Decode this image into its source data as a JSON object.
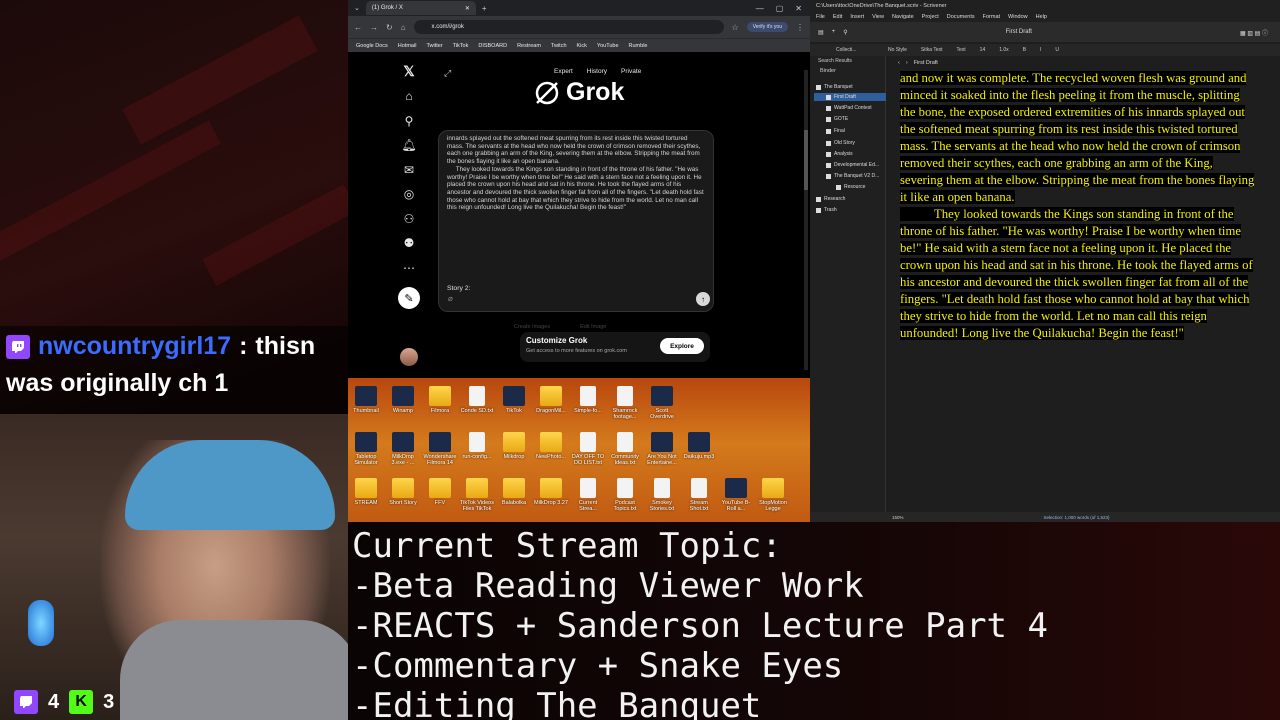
{
  "chat": {
    "username": "nwcountrygirl17",
    "colon": ":",
    "message_part1": "thisn",
    "message_part2": "was originally ch 1"
  },
  "counters": {
    "twitch_count": "4",
    "kick_count": "3",
    "kick_letter": "K"
  },
  "browser": {
    "tab_title": "(1) Grok / X",
    "url": "x.com/i/grok",
    "verify_label": "Verify it's you",
    "bookmarks": [
      "Google Docs",
      "Hotmail",
      "Twitter",
      "TikTok",
      "DISBOARD",
      "Restream",
      "Twitch",
      "Kick",
      "YouTube",
      "Rumble"
    ]
  },
  "grok": {
    "mode": "Expert",
    "history": "History",
    "private": "Private",
    "logo_text": "Grok",
    "message": "innards splayed out the softened meat spurring from its rest inside this twisted tortured mass. The servants at the head who now held the crown of crimson removed their scythes, each one grabbing an arm of the King, severing them at the elbow. Stripping the meat from the bones flaying it like an open banana.\n     They looked towards the Kings son standing in front of the throne of his father. \"He was worthy! Praise I be worthy when time be!\" He said with a stern face not a feeling upon it. He placed the crown upon his head and sat in his throne. He took the flayed arms of his ancestor and devoured the thick swollen finger fat from all of the fingers. \"Let death hold fast those who cannot hold at bay that which they strive to hide from the world. Let no man call this reign unfounded! Long live the Quilakucha! Begin the feast!\"",
    "story_label": "Story 2:",
    "ghost_create": "Create Images",
    "ghost_edit": "Edit Image",
    "customize_title": "Customize Grok",
    "customize_sub": "Get access to more features on grok.com",
    "explore": "Explore"
  },
  "desktop": {
    "row1": [
      "Thumbnail",
      "Winamp",
      "Filmora",
      "Conde SD.txt",
      "TikTok",
      "DragonMil...",
      "Simple-fo...",
      "Shamrock footage...",
      "Scott Overdrive"
    ],
    "row2": [
      "Tabletop Simulator",
      "MilkDrop 3.exe - ...",
      "Wondershare Filmora 14",
      "run-config...",
      "Milkdrop",
      "NewPhoto...",
      "DAY OFF TO DO LIST.txt",
      "Community Ideas.txt",
      "Are You Not Entertaine...",
      "Daikuju.mp3"
    ],
    "row3": [
      "STREAM",
      "Short Story",
      "FFV",
      "TikTok Videos Files TikTok",
      "Balabolka",
      "MilkDrop 3.27",
      "Current Strea...",
      "Podcast Topics.txt",
      "Smokey Stories.txt",
      "Stream Shot.txt",
      "YouTube B-Roll a...",
      "StopMotion Legge"
    ]
  },
  "scrivener": {
    "window_title": "C:\\Users\\ttoc\\OneDrive\\The Banquet.scriv - Scrivener",
    "menu": [
      "File",
      "Edit",
      "Insert",
      "View",
      "Navigate",
      "Project",
      "Documents",
      "Format",
      "Window",
      "Help"
    ],
    "toolbar_doc": "First Draft",
    "collections": "Collecti...",
    "format_bar": [
      "No Style",
      "Sitka Text",
      "Text",
      "14",
      "1.0x"
    ],
    "binder_header": "Binder",
    "search_results": "Search Results",
    "binder": [
      "The Banquet",
      "First Draft",
      "WattPad Contest",
      "GOTE",
      "Final",
      "Old Story",
      "Analysis",
      "Developmental Ed...",
      "The Banquet V2 D...",
      "Resource",
      "Research",
      "Trash"
    ],
    "editor_title": "First Draft",
    "editor_text_1": "and now it was complete. The recycled woven flesh was ground and minced it soaked into the flesh peeling it from the muscle, splitting the bone, the exposed ordered extremities of his innards splayed out the softened meat spurring from its rest inside this twisted tortured mass. The servants at the head who now held the crown of crimson removed their scythes, each one grabbing an arm of the King, severing them at the elbow. Stripping the meat from the bones flaying it like an open banana.",
    "editor_text_2": "They looked towards the Kings son standing in front of the throne of his father. \"He was worthy! Praise I be worthy when time be!\" He said with a stern face not a feeling upon it. He placed the crown upon his head and sat in his throne. He took the flayed arms of his ancestor and devoured the thick swollen finger fat from all of the fingers. \"Let death hold fast those who cannot hold at bay that which they strive to hide from the world. Let no man call this reign unfounded! Long live the Quilakucha! Begin the feast!\"",
    "zoom": "150%",
    "selection": "Selection: 1,000 words (of 1,523)"
  },
  "topic": {
    "header": "Current Stream Topic:",
    "items": [
      "-Beta Reading Viewer Work",
      "-REACTS + Sanderson Lecture Part 4",
      "-Commentary + Snake Eyes",
      "-Editing The Banquet"
    ]
  },
  "colors": {
    "twitch": "#9146ff",
    "kick": "#53fc18",
    "chat_user": "#3b6cff",
    "highlight_text": "#f3f000"
  }
}
